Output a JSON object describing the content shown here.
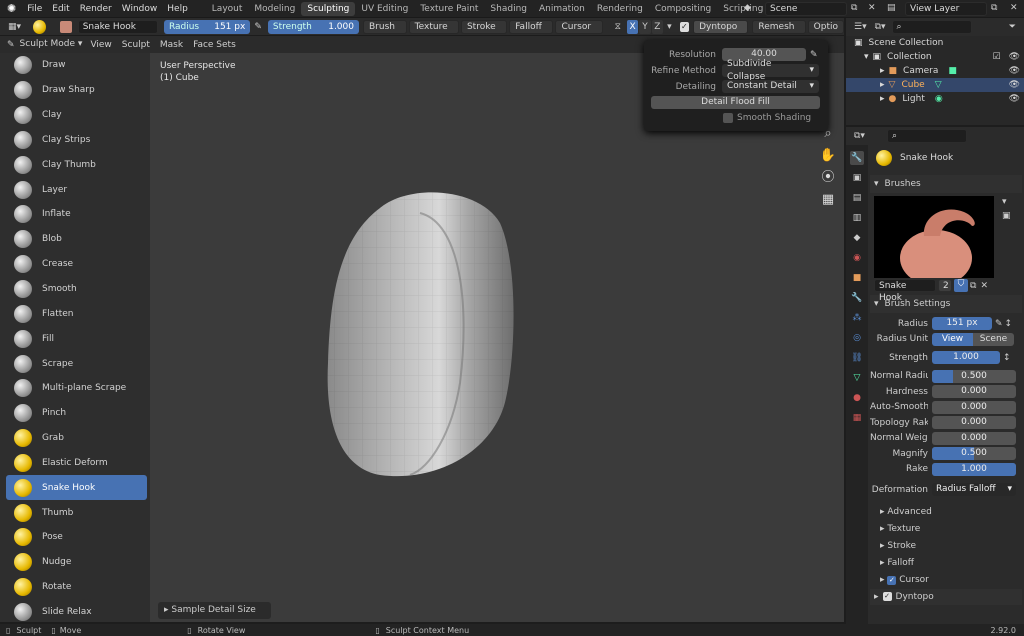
{
  "topbar": {
    "menu": [
      "File",
      "Edit",
      "Render",
      "Window",
      "Help"
    ],
    "workspaces": [
      "Layout",
      "Modeling",
      "Sculpting",
      "UV Editing",
      "Texture Paint",
      "Shading",
      "Animation",
      "Rendering",
      "Compositing",
      "Scripting"
    ],
    "active_workspace": "Sculpting",
    "add_label": "+",
    "scene": "Scene",
    "view_layer": "View Layer"
  },
  "toolheader": {
    "brush_name": "Snake Hook",
    "radius_label": "Radius",
    "radius_value": "151 px",
    "strength_label": "Strength",
    "strength_value": "1.000",
    "menus": [
      "Brush",
      "Texture",
      "Stroke",
      "Falloff",
      "Cursor"
    ],
    "axes": [
      "X",
      "Y",
      "Z"
    ],
    "dyntopo": "Dyntopo",
    "remesh": "Remesh",
    "options": "Optio"
  },
  "modeheader": {
    "mode": "Sculpt Mode",
    "menus": [
      "View",
      "Sculpt",
      "Mask",
      "Face Sets"
    ]
  },
  "tools": [
    "Draw",
    "Draw Sharp",
    "Clay",
    "Clay Strips",
    "Clay Thumb",
    "Layer",
    "Inflate",
    "Blob",
    "Crease",
    "Smooth",
    "Flatten",
    "Fill",
    "Scrape",
    "Multi-plane Scrape",
    "Pinch",
    "Grab",
    "Elastic Deform",
    "Snake Hook",
    "Thumb",
    "Pose",
    "Nudge",
    "Rotate",
    "Slide Relax"
  ],
  "active_tool": "Snake Hook",
  "viewport": {
    "perspective": "User Perspective",
    "object": "(1) Cube",
    "last_op": "Sample Detail Size"
  },
  "popover": {
    "resolution_label": "Resolution",
    "resolution_value": "40.00",
    "refine_label": "Refine Method",
    "refine_value": "Subdivide Collapse",
    "detailing_label": "Detailing",
    "detailing_value": "Constant Detail",
    "flood_fill": "Detail Flood Fill",
    "smooth_shading": "Smooth Shading"
  },
  "outliner": {
    "rows": [
      {
        "label": "Scene Collection"
      },
      {
        "label": "Collection"
      },
      {
        "label": "Camera"
      },
      {
        "label": "Cube"
      },
      {
        "label": "Light"
      }
    ]
  },
  "properties": {
    "brush_name": "Snake Hook",
    "brushes_panel": "Brushes",
    "brush_field": "Snake Hook",
    "users": "2",
    "brush_settings_panel": "Brush Settings",
    "radius_label": "Radius",
    "radius_value": "151 px",
    "radius_unit_label": "Radius Unit",
    "radius_unit_options": [
      "View",
      "Scene"
    ],
    "strength_label": "Strength",
    "strength_value": "1.000",
    "sliders": [
      {
        "label": "Normal Radiu",
        "value": "0.500",
        "fill": 0.25
      },
      {
        "label": "Hardness",
        "value": "0.000",
        "fill": 0
      },
      {
        "label": "Auto-Smooth",
        "value": "0.000",
        "fill": 0
      },
      {
        "label": "Topology Rak",
        "value": "0.000",
        "fill": 0
      },
      {
        "label": "Normal Weig...",
        "value": "0.000",
        "fill": 0
      },
      {
        "label": "Magnify",
        "value": "0.500",
        "fill": 0.5
      },
      {
        "label": "Rake",
        "value": "1.000",
        "fill": 1
      }
    ],
    "deformation_label": "Deformation",
    "deformation_value": "Radius Falloff",
    "subpanels": [
      "Advanced",
      "Texture",
      "Stroke",
      "Falloff",
      "Cursor"
    ],
    "dyntopo_panel": "Dyntopo"
  },
  "statusbar": {
    "items": [
      "Sculpt",
      "Move",
      "Rotate View",
      "Sculpt Context Menu"
    ],
    "version": "2.92.0"
  }
}
